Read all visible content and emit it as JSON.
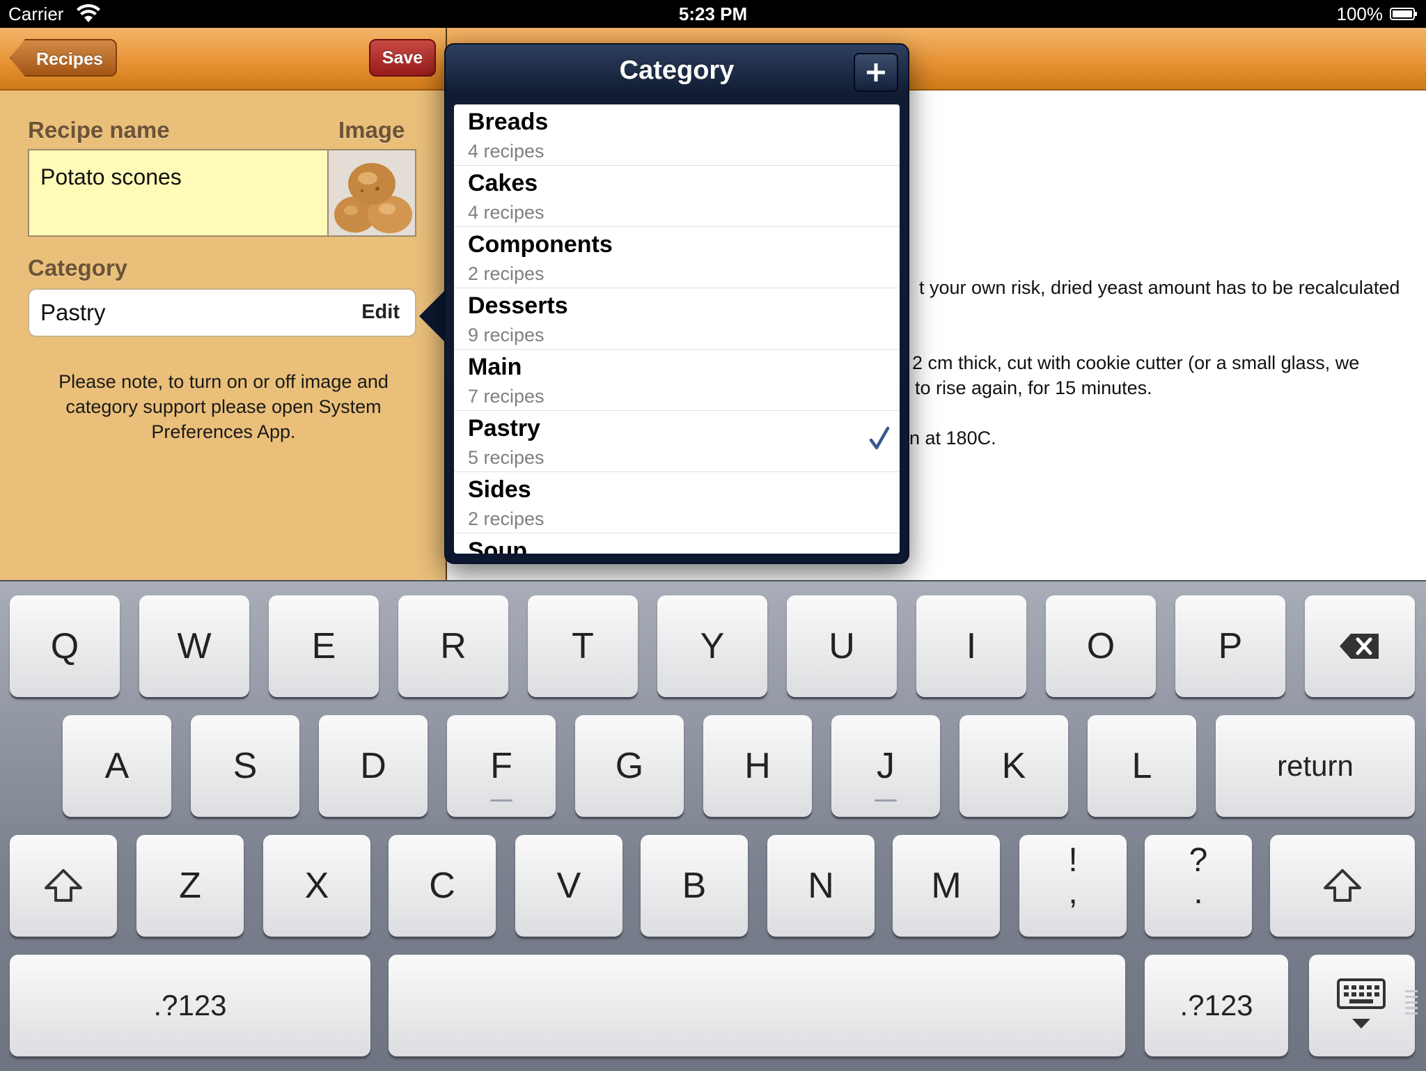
{
  "status_bar": {
    "carrier": "Carrier",
    "time": "5:23 PM",
    "battery": "100%"
  },
  "master": {
    "back_label": "Recipes",
    "save_label": "Save",
    "recipe_name_label": "Recipe name",
    "image_label": "Image",
    "recipe_name_value": "Potato scones",
    "category_label": "Category",
    "category_value": "Pastry",
    "edit_label": "Edit",
    "note": "Please note, to turn on or off image and category support please open System Preferences App."
  },
  "detail": {
    "lines": [
      "t your own risk, dried yeast amount has to be recalculated",
      "2 cm thick, cut with cookie cutter (or a small glass, we",
      "to rise again, for 15 minutes.",
      "n at 180C."
    ]
  },
  "popover": {
    "title": "Category",
    "add_icon": "plus-icon",
    "selected": "Pastry",
    "categories": [
      {
        "name": "Breads",
        "count": "4 recipes"
      },
      {
        "name": "Cakes",
        "count": "4 recipes"
      },
      {
        "name": "Components",
        "count": "2 recipes"
      },
      {
        "name": "Desserts",
        "count": "9 recipes"
      },
      {
        "name": "Main",
        "count": "7 recipes"
      },
      {
        "name": "Pastry",
        "count": "5 recipes"
      },
      {
        "name": "Sides",
        "count": "2 recipes"
      },
      {
        "name": "Soup",
        "count": ""
      }
    ]
  },
  "keyboard": {
    "row1": [
      "Q",
      "W",
      "E",
      "R",
      "T",
      "Y",
      "U",
      "I",
      "O",
      "P"
    ],
    "row2": [
      "A",
      "S",
      "D",
      "F",
      "G",
      "H",
      "J",
      "K",
      "L"
    ],
    "row3": [
      "Z",
      "X",
      "C",
      "V",
      "B",
      "N",
      "M"
    ],
    "return_label": "return",
    "punct1": [
      "!",
      ","
    ],
    "punct2": [
      "?",
      "."
    ],
    "numbers_label": ".?123",
    "icons": [
      "backspace-icon",
      "shift-icon",
      "hide-keyboard-icon"
    ]
  },
  "colors": {
    "nav_orange": "#e89436",
    "master_bg": "#eabf7a",
    "name_field_bg": "#fefab7",
    "save_red": "#b7302c",
    "popover_navy": "#111c33",
    "checkmark": "#3b5791"
  }
}
